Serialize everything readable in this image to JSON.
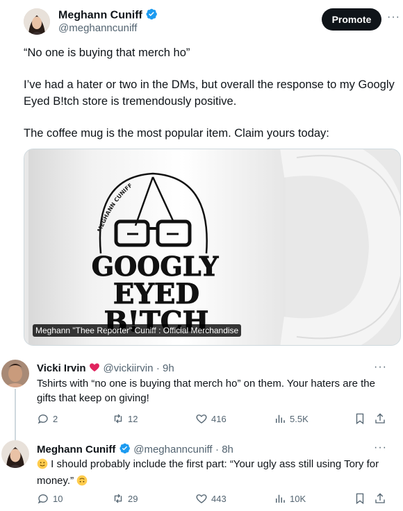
{
  "tweet": {
    "author_name": "Meghann Cuniff",
    "author_handle": "@meghanncuniff",
    "promote_label": "Promote",
    "more_label": "···",
    "paragraphs": [
      "“No one is buying that merch ho”",
      "I’ve had a hater or two in the DMs, but overall the response to my Googly Eyed B!tch store is tremendously positive.",
      "The coffee mug is the most popular item. Claim yours today:"
    ],
    "media_caption": "Meghann \"Thee Reporter\" Cuniff : Official Merchandise",
    "mug_text": {
      "ring": "MEGHANN CUNIFF",
      "line1": "GOOGLY",
      "line2": "EYED",
      "line3": "B!TCH"
    }
  },
  "replies": [
    {
      "name": "Vicki Irvin",
      "handle": "@vickiirvin",
      "time": "· 9h",
      "text": "Tshirts with “no one is buying that merch ho” on them. Your haters are the gifts that keep on giving!",
      "replies": "2",
      "retweets": "12",
      "likes": "416",
      "views": "5.5K"
    },
    {
      "name": "Meghann Cuniff",
      "handle": "@meghanncuniff",
      "time": "· 8h",
      "text": "I should probably include the first part: “Your ugly ass still using Tory for money.”",
      "replies": "10",
      "retweets": "29",
      "likes": "443",
      "views": "10K"
    }
  ],
  "icons": {
    "verified": "verified-badge-icon",
    "heart": "red-heart-icon",
    "reply": "reply-icon",
    "retweet": "retweet-icon",
    "like": "like-icon",
    "views": "views-icon",
    "bookmark": "bookmark-icon",
    "share": "share-icon",
    "emoji": "slightly-smiling-face-icon"
  },
  "colors": {
    "verified": "#1d9bf0",
    "secondary_text": "#536471",
    "promote_bg": "#0f1419"
  }
}
